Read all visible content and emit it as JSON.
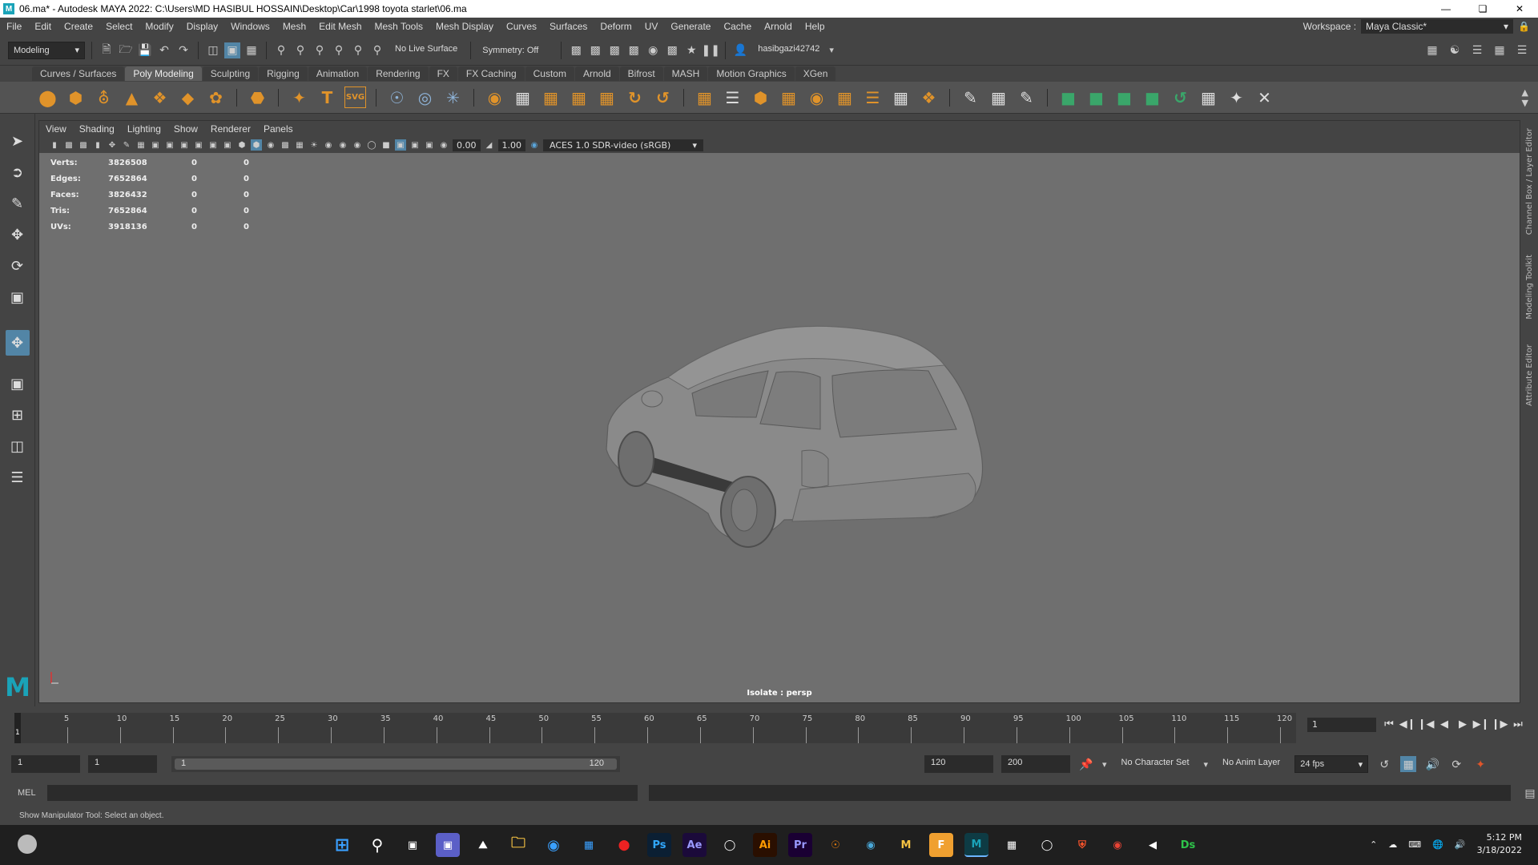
{
  "window": {
    "title": "06.ma* - Autodesk MAYA 2022: C:\\Users\\MD HASIBUL HOSSAIN\\Desktop\\Car\\1998 toyota starlet\\06.ma"
  },
  "menu": {
    "items": [
      "File",
      "Edit",
      "Create",
      "Select",
      "Modify",
      "Display",
      "Windows",
      "Mesh",
      "Edit Mesh",
      "Mesh Tools",
      "Mesh Display",
      "Curves",
      "Surfaces",
      "Deform",
      "UV",
      "Generate",
      "Cache",
      "Arnold",
      "Help"
    ],
    "workspace_label": "Workspace :",
    "workspace_value": "Maya Classic*"
  },
  "statusline": {
    "mode": "Modeling",
    "live_surface": "No Live Surface",
    "symmetry": "Symmetry: Off",
    "user": "hasibgazi42742"
  },
  "shelf": {
    "tabs": [
      "Curves / Surfaces",
      "Poly Modeling",
      "Sculpting",
      "Rigging",
      "Animation",
      "Rendering",
      "FX",
      "FX Caching",
      "Custom",
      "Arnold",
      "Bifrost",
      "MASH",
      "Motion Graphics",
      "XGen"
    ],
    "active_tab": "Poly Modeling",
    "text_icon": "T",
    "svg_icon": "SVG"
  },
  "panel": {
    "menus": [
      "View",
      "Shading",
      "Lighting",
      "Show",
      "Renderer",
      "Panels"
    ],
    "exposure": "0.00",
    "gamma": "1.00",
    "color_space": "ACES 1.0 SDR-video (sRGB)"
  },
  "hud": {
    "rows": [
      {
        "label": "Verts:",
        "v1": "3826508",
        "v2": "0",
        "v3": "0"
      },
      {
        "label": "Edges:",
        "v1": "7652864",
        "v2": "0",
        "v3": "0"
      },
      {
        "label": "Faces:",
        "v1": "3826432",
        "v2": "0",
        "v3": "0"
      },
      {
        "label": "Tris:",
        "v1": "7652864",
        "v2": "0",
        "v3": "0"
      },
      {
        "label": "UVs:",
        "v1": "3918136",
        "v2": "0",
        "v3": "0"
      }
    ]
  },
  "viewport": {
    "isolate_label": "Isolate : persp"
  },
  "right_tabs": [
    "Channel Box / Layer Editor",
    "Modeling Toolkit",
    "Attribute Editor"
  ],
  "timeline": {
    "tick_labels": [
      "5",
      "10",
      "15",
      "20",
      "25",
      "30",
      "35",
      "40",
      "45",
      "50",
      "55",
      "60",
      "65",
      "70",
      "75",
      "80",
      "85",
      "90",
      "95",
      "100",
      "105",
      "110",
      "115",
      "120"
    ],
    "current_frame_marker": "1",
    "current_frame": "1"
  },
  "range": {
    "start": "1",
    "playback_start": "1",
    "range_start_label": "1",
    "range_end_label": "120",
    "playback_end": "120",
    "end": "200",
    "character_set": "No Character Set",
    "anim_layer": "No Anim Layer",
    "fps": "24 fps"
  },
  "command": {
    "label": "MEL"
  },
  "help": {
    "text": "Show Manipulator Tool: Select an object."
  },
  "taskbar": {
    "app_labels": [
      "Ps",
      "Ae",
      "Ai",
      "Pr",
      "M",
      "F",
      "Ds"
    ],
    "time": "5:12 PM",
    "date": "3/18/2022"
  }
}
